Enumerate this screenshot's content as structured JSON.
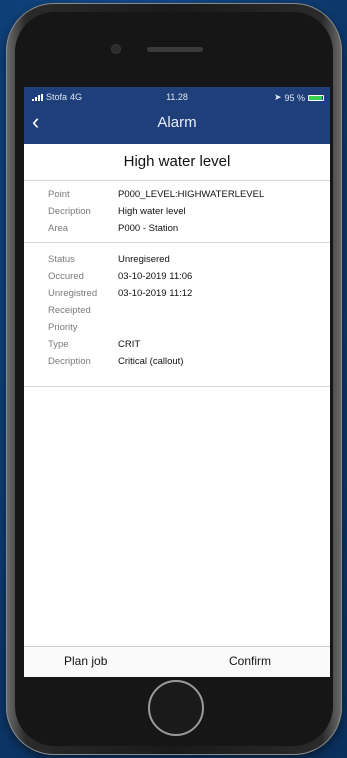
{
  "status_bar": {
    "carrier": "Stofa",
    "network": "4G",
    "time": "11.28",
    "battery_percent": "95 %"
  },
  "nav": {
    "title": "Alarm"
  },
  "alarm": {
    "heading": "High water level",
    "point_label": "Point",
    "point_value": "P000_LEVEL:HIGHWATERLEVEL",
    "description_label": "Decription",
    "description_value": "High water level",
    "area_label": "Area",
    "area_value": "P000 - Station"
  },
  "details": {
    "status_label": "Status",
    "status_value": "Unregisered",
    "occured_label": "Occured",
    "occured_value": "03-10-2019 11:06",
    "unregistred_label": "Unregistred",
    "unregistred_value": "03-10-2019 11:12",
    "receipted_label": "Receipted",
    "receipted_value": "",
    "priority_label": "Priority",
    "priority_value": "",
    "type_label": "Type",
    "type_value": "CRIT",
    "description_label": "Decription",
    "description_value": "Critical (callout)"
  },
  "actions": {
    "plan_job": "Plan job",
    "confirm": "Confirm"
  },
  "colors": {
    "nav_bg": "#1e3f79",
    "background": "#0e3f78",
    "battery": "#39d353"
  }
}
